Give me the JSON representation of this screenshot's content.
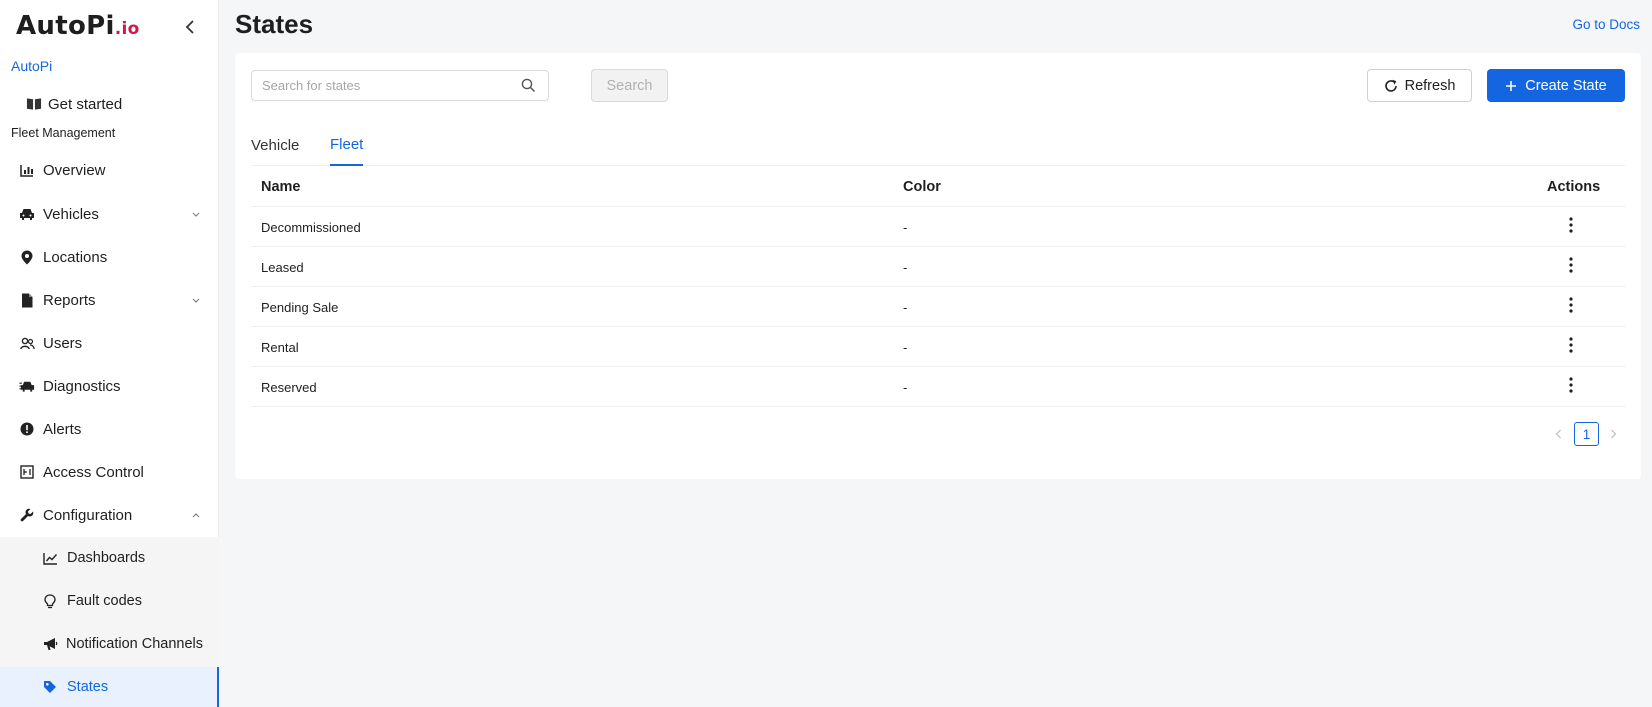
{
  "brand": {
    "logo_main": "AutoPi",
    "logo_suffix": ".io",
    "org": "AutoPi"
  },
  "sidebar": {
    "get_started": "Get started",
    "section": "Fleet Management",
    "items": [
      {
        "label": "Overview",
        "icon": "chart-icon"
      },
      {
        "label": "Vehicles",
        "icon": "car-icon"
      },
      {
        "label": "Locations",
        "icon": "map-pin-icon"
      },
      {
        "label": "Reports",
        "icon": "document-icon"
      },
      {
        "label": "Users",
        "icon": "users-icon"
      },
      {
        "label": "Diagnostics",
        "icon": "car-diagnostic-icon"
      },
      {
        "label": "Alerts",
        "icon": "alert-icon"
      },
      {
        "label": "Access Control",
        "icon": "access-control-icon"
      },
      {
        "label": "Configuration",
        "icon": "wrench-icon"
      }
    ],
    "submenu": [
      {
        "label": "Dashboards",
        "icon": "line-chart-icon"
      },
      {
        "label": "Fault codes",
        "icon": "lightbulb-icon"
      },
      {
        "label": "Notification Channels",
        "icon": "megaphone-icon"
      },
      {
        "label": "States",
        "icon": "tag-icon",
        "active": true
      }
    ]
  },
  "header": {
    "title": "States",
    "docs_link": "Go to Docs"
  },
  "toolbar": {
    "search_placeholder": "Search for states",
    "search_button": "Search",
    "refresh_button": "Refresh",
    "create_button": "Create State"
  },
  "tabs": [
    "Vehicle",
    "Fleet"
  ],
  "active_tab": "Fleet",
  "table": {
    "columns": [
      "Name",
      "Color",
      "Actions"
    ],
    "rows": [
      {
        "name": "Decommissioned",
        "color": "-"
      },
      {
        "name": "Leased",
        "color": "-"
      },
      {
        "name": "Pending Sale",
        "color": "-"
      },
      {
        "name": "Rental",
        "color": "-"
      },
      {
        "name": "Reserved",
        "color": "-"
      }
    ]
  },
  "pagination": {
    "current_page": "1"
  },
  "colors": {
    "accent": "#1466e0",
    "logo_accent": "#d0184a"
  }
}
